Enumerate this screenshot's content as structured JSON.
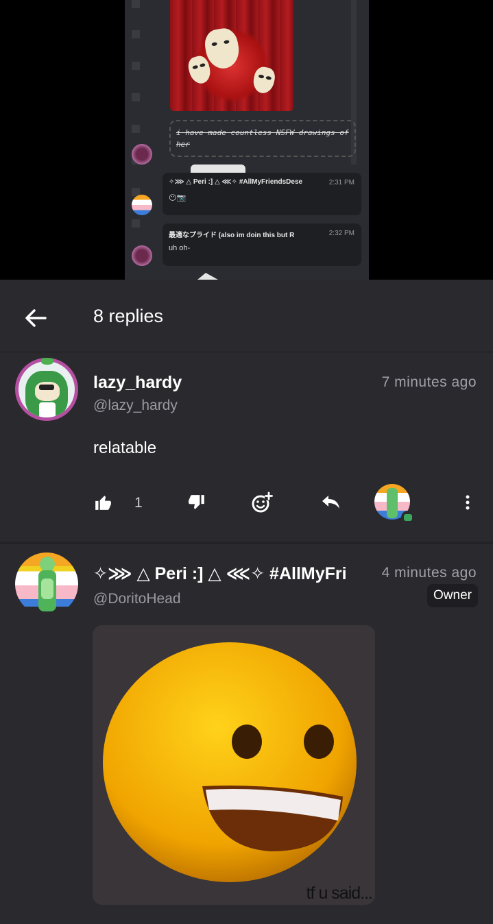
{
  "media": {
    "strike_text": "i have made countless NSFW drawings of her",
    "messages": [
      {
        "name": "✧⋙ △ Peri :] △ ⋘✧ #AllMyFriendsDese",
        "time": "2:31 PM",
        "text": "😶📷"
      },
      {
        "name": "最適なプライド (also im doin this but R",
        "time": "2:32 PM",
        "text": "uh oh-"
      }
    ]
  },
  "header": {
    "title": "8 replies",
    "back_icon": "arrow-left-icon"
  },
  "comments": [
    {
      "username": "lazy_hardy",
      "handle": "@lazy_hardy",
      "time": "7 minutes ago",
      "text": "relatable",
      "like_count": "1",
      "avatar_ring": "#b54fa2",
      "avatar_bg": "#2f8f3e"
    },
    {
      "username": "✧⋙ △ Peri :] △ ⋘✧ #AllMyFri",
      "handle": "@DoritoHead",
      "time": "4 minutes ago",
      "badge": "Owner",
      "gif_caption": "tf u said..."
    }
  ],
  "colors": {
    "background": "#2a292e",
    "media_bg": "#000000",
    "muted": "#9b9aa1",
    "online": "#3ba55c"
  }
}
